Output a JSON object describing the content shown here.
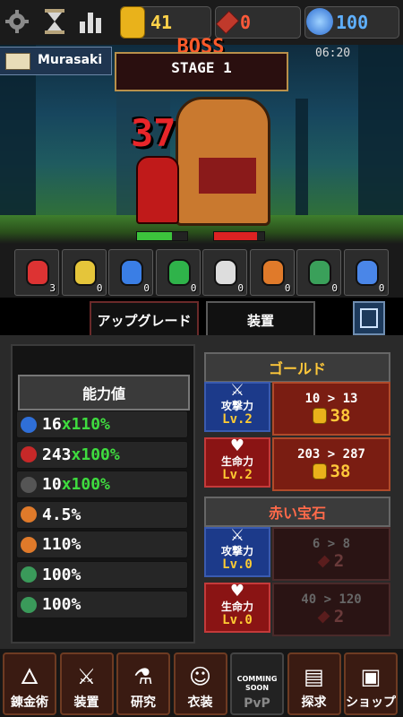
{
  "top_bar": {
    "icons": [
      "gear-icon",
      "hourglass-icon",
      "stats-icon"
    ],
    "gold": "41",
    "red_gems": "0",
    "blue_gems": "100"
  },
  "battle": {
    "player_name": "Murasaki",
    "boss_label": "BOSS",
    "stage": "STAGE 1",
    "time": "06:20",
    "damage": "37",
    "player_hp": 0.7,
    "boss_hp": 0.85
  },
  "items": [
    {
      "icon": "red-potion-icon",
      "count": "3",
      "color": "#d33"
    },
    {
      "icon": "yellow-potion-icon",
      "count": "0",
      "color": "#e5c53a"
    },
    {
      "icon": "blue-potion-icon",
      "count": "0",
      "color": "#3a7ee5"
    },
    {
      "icon": "green-potion-icon",
      "count": "0",
      "color": "#2fb34a"
    },
    {
      "icon": "white-potion-icon",
      "count": "0",
      "color": "#dddddd"
    },
    {
      "icon": "explosion-icon",
      "count": "0",
      "color": "#e07a2a"
    },
    {
      "icon": "skull-icon",
      "count": "0",
      "color": "#3aa05a"
    },
    {
      "icon": "blue-flame-icon",
      "count": "0",
      "color": "#4a86e8"
    }
  ],
  "tabs": {
    "upgrade": "アップグレード",
    "equipment": "装置"
  },
  "stats": {
    "title": "能力値",
    "rows": [
      {
        "icon": "sword-icon",
        "color": "#2f6fd8",
        "base": "16",
        "mult": "x110%"
      },
      {
        "icon": "heart-icon",
        "color": "#c62828",
        "base": "243",
        "mult": "x100%"
      },
      {
        "icon": "shield-icon",
        "color": "#555555",
        "base": "10",
        "mult": "x100%"
      },
      {
        "icon": "critical-icon",
        "color": "#e07a2a",
        "base": "4.5%",
        "mult": ""
      },
      {
        "icon": "critical-damage-icon",
        "color": "#e07a2a",
        "base": "110%",
        "mult": ""
      },
      {
        "icon": "speed-icon",
        "color": "#3a9a5a",
        "base": "100%",
        "mult": ""
      },
      {
        "icon": "sword-green-icon",
        "color": "#3a9a5a",
        "base": "100%",
        "mult": ""
      }
    ]
  },
  "gold_section": {
    "title": "ゴールド",
    "attack": {
      "name": "攻撃力",
      "level": "Lv.2",
      "range": "10 > 13",
      "price": "38"
    },
    "hp": {
      "name": "生命力",
      "level": "Lv.2",
      "range": "203 > 287",
      "price": "38"
    }
  },
  "gem_section": {
    "title": "赤い宝石",
    "attack": {
      "name": "攻撃力",
      "level": "Lv.0",
      "range": "6 > 8",
      "price": "2"
    },
    "hp": {
      "name": "生命力",
      "level": "Lv.0",
      "range": "40 > 120",
      "price": "2"
    }
  },
  "nav": [
    {
      "label": "錬金術",
      "icon": "alchemy-icon"
    },
    {
      "label": "装置",
      "icon": "sword-shield-icon"
    },
    {
      "label": "研究",
      "icon": "research-icon"
    },
    {
      "label": "衣装",
      "icon": "costume-icon"
    },
    {
      "label": "PvP",
      "icon": "crossed-swords-icon",
      "note1": "COMMING",
      "note2": "SOON"
    },
    {
      "label": "探求",
      "icon": "scroll-icon"
    },
    {
      "label": "ショップ",
      "icon": "treasure-chest-icon"
    }
  ]
}
